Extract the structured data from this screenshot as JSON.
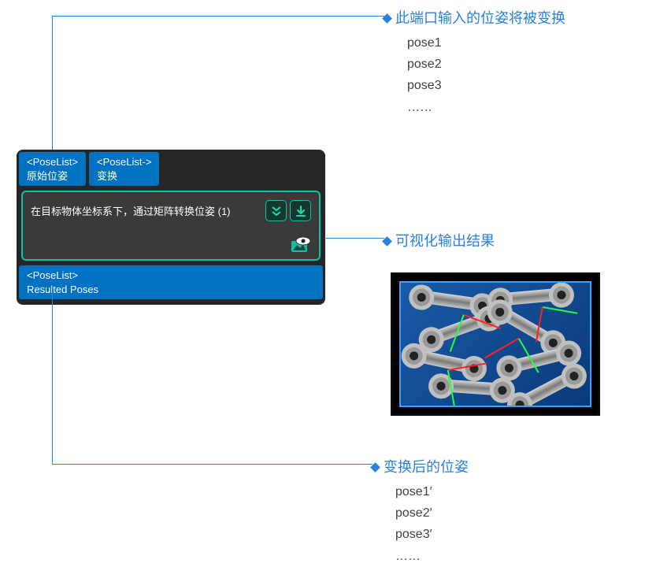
{
  "annotations": {
    "input": {
      "title": "此端口输入的位姿将被变换",
      "items": [
        "pose1",
        "pose2",
        "pose3",
        "……"
      ]
    },
    "viz": {
      "title": "可视化输出结果"
    },
    "output": {
      "title": "变换后的位姿",
      "items": [
        "pose1′",
        "pose2′",
        "pose3′",
        "……"
      ]
    }
  },
  "node": {
    "ports_in": [
      {
        "type": "<PoseList>",
        "label": "原始位姿"
      },
      {
        "type": "<PoseList->",
        "label": "变换"
      }
    ],
    "body_title": "在目标物体坐标系下，通过矩阵转换位姿 (1)",
    "ports_out": [
      {
        "type": "<PoseList>",
        "label": "Resulted Poses"
      }
    ]
  },
  "icons": {
    "expand": "expand-down-icon",
    "download": "download-arrow-icon",
    "visualize": "eye-image-icon"
  },
  "colors": {
    "accent_blue": "#2881df",
    "port_blue": "#0072c1",
    "node_bg": "#262626",
    "body_teal": "#0ec3a3",
    "btn_icon": "#10e0b5"
  }
}
